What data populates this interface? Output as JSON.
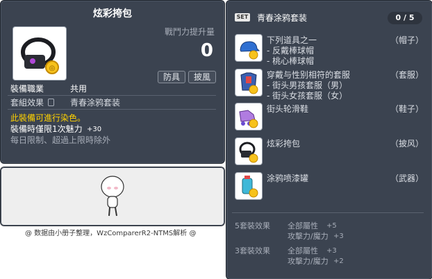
{
  "item_id": "01103881",
  "item": {
    "name": "炫彩挎包",
    "atk_increase_label": "戰鬥力提升量",
    "atk_increase_value": "0",
    "tags": [
      "防具",
      "披風"
    ],
    "job_label": "裝備職業",
    "job_value": "共用",
    "set_label": "套組效果",
    "set_value": "青春涂鸦套装",
    "dye_note": "此裝備可進行染色。",
    "equip_charm_label": "裝備時僅限1次魅力",
    "equip_charm_value": "+30",
    "daily_limit": "每日限制、超過上限時除外"
  },
  "footer_credit": "@ 数据由小册子整理，WzComparerR2-NTMS解析 @",
  "set_panel": {
    "badge": "SET",
    "title": "青春涂鸦套装",
    "count": "0 / 5",
    "items": [
      {
        "icon": "cap-icon",
        "lines": [
          "下列道具之一",
          "- 反戴棒球帽",
          "- 桃心棒球帽"
        ],
        "slot": "（帽子）"
      },
      {
        "icon": "outfit-icon",
        "lines": [
          "穿戴与性别相符的套服",
          "- 街头男孩套服（男）",
          "- 街头女孩套服（女）"
        ],
        "slot": "（套服）"
      },
      {
        "icon": "skates-icon",
        "lines": [
          "街头轮滑鞋"
        ],
        "slot": "（鞋子）"
      },
      {
        "icon": "bag-icon",
        "lines": [
          "炫彩挎包"
        ],
        "slot": "（披风）"
      },
      {
        "icon": "spray-can-icon",
        "lines": [
          "涂鸦喷漆罐"
        ],
        "slot": "（武器）"
      }
    ],
    "effects": [
      {
        "title": "5套裝效果",
        "lines": [
          [
            "全部屬性",
            "+5"
          ],
          [
            "攻擊力/魔力",
            "+3"
          ]
        ]
      },
      {
        "title": "3套裝效果",
        "lines": [
          [
            "全部屬性",
            "+3"
          ],
          [
            "攻擊力/魔力",
            "+2"
          ]
        ]
      }
    ]
  },
  "colors": {
    "panel_bg": "#3b4350",
    "yellow": "#ffd200",
    "grey_text": "#a7adb8"
  }
}
